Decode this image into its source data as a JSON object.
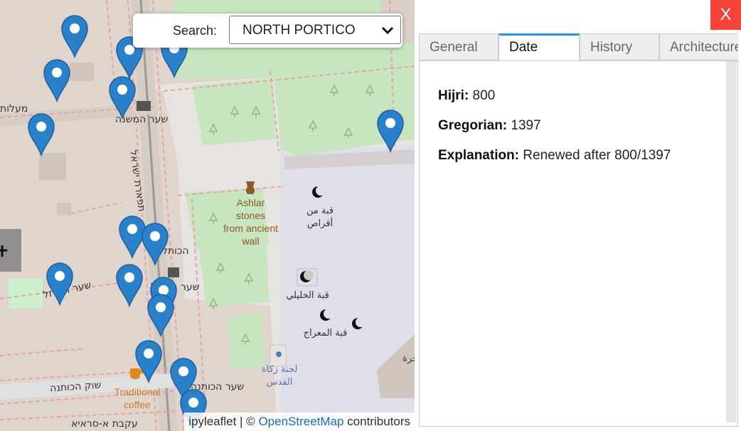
{
  "search": {
    "label": "Search:",
    "value": "NORTH PORTICO"
  },
  "attribution": {
    "prefix": "ipyleaflet | © ",
    "link": "OpenStreetMap",
    "suffix": " contributors"
  },
  "map_labels": {
    "heb_maalot": "מעלות",
    "heb_shaar_hamishna": "שער המשנה",
    "heb_tiferet": "תפארת ישראל",
    "heb_hakotel": "הכותל",
    "heb_shaar_hakotel": "שער הכותל",
    "heb_shaar_habarzel": "שער הברזל",
    "heb_shuk_hakotna": "שוק הכותנה",
    "heb_shaar_kotna": "שער הכותנה",
    "heb_akavat": "עקבת א-סראיא",
    "ashlar_line1": "Ashlar",
    "ashlar_line2": "stones",
    "ashlar_line3": "from ancient",
    "ashlar_line4": "wall",
    "ar_qubba_aqras_1": "قبة من",
    "ar_qubba_aqras_2": "أقراص",
    "ar_khalili": "قبة الخليلي",
    "ar_miraj": "قبة المعراج",
    "ar_zakat_1": "لجنة زكاة",
    "ar_zakat_2": "القدس",
    "ar_sakhra": "الصخرة",
    "traditional_1": "Traditional",
    "traditional_2": "coffee"
  },
  "colors": {
    "marker": "#2a81cb",
    "close": "#f44336",
    "tab_accent": "#2196f3"
  },
  "panel": {
    "close_label": "X",
    "tabs": [
      {
        "label": "General"
      },
      {
        "label": "Date"
      },
      {
        "label": "History"
      },
      {
        "label": "Architecture"
      }
    ],
    "active_tab": "Date",
    "fields": {
      "hijri_label": "Hijri:",
      "hijri_value": " 800",
      "gregorian_label": "Gregorian:",
      "gregorian_value": " 1397",
      "explanation_label": "Explanation:",
      "explanation_value": " Renewed after 800/1397"
    }
  }
}
